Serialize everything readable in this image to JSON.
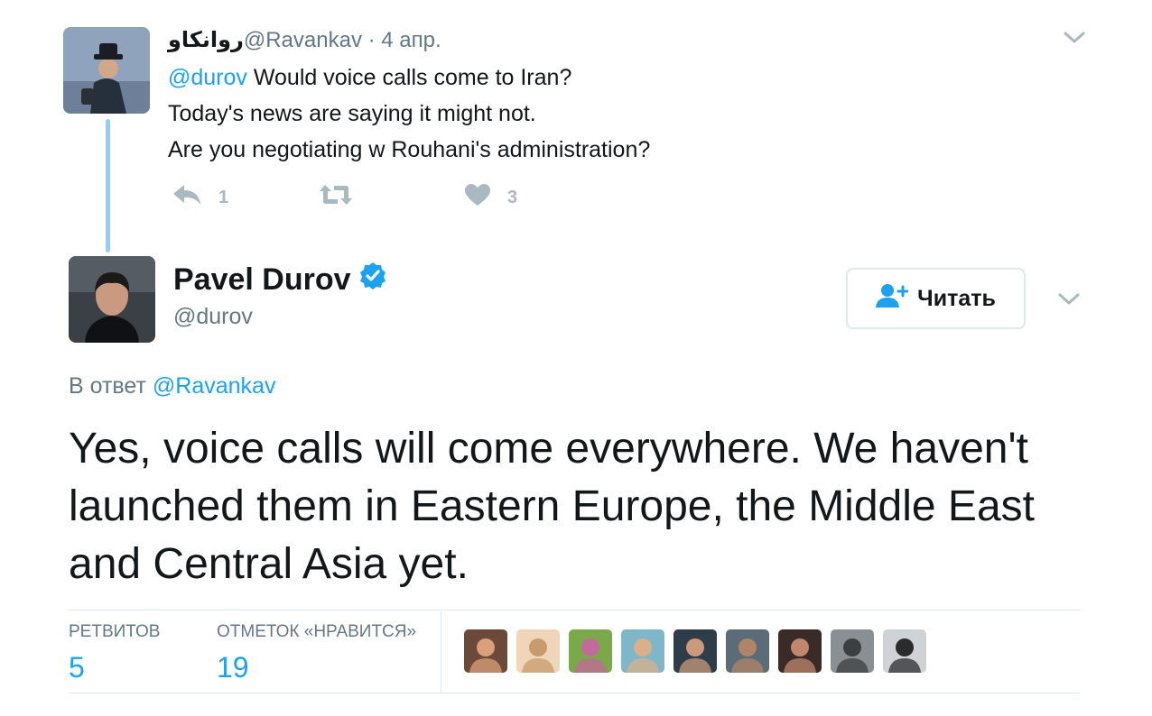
{
  "reply_tweet": {
    "author_name": "روانکاو",
    "author_handle": "@Ravankav",
    "separator": " · ",
    "date": "4 апр.",
    "mention": "@durov",
    "text_line1": " Would voice calls come to Iran?",
    "text_line2": "Today's news are saying it might not.",
    "text_line3": "Are you negotiating w Rouhani's administration?",
    "reply_count": "1",
    "like_count": "3"
  },
  "main_tweet": {
    "author_name": "Pavel Durov",
    "author_handle": "@durov",
    "follow_label": "Читать",
    "replying_prefix": "В ответ ",
    "replying_to": "@Ravankav",
    "text": "Yes, voice calls will come everywhere. We haven't launched them in Eastern Europe, the Middle East and Central Asia yet."
  },
  "stats": {
    "retweets_label": "РЕТВИТОВ",
    "retweets_value": "5",
    "likes_label": "ОТМЕТОК «НРАВИТСЯ»",
    "likes_value": "19"
  },
  "colors": {
    "accent": "#1da1f2",
    "thread_line": "#8ed0f9",
    "muted": "#657786",
    "icon_muted": "#aab8c2"
  },
  "likers": [
    {
      "name": "liker-avatar-1",
      "bg": "#6b4a3a",
      "fg": "#d9a07a"
    },
    {
      "name": "liker-avatar-2",
      "bg": "#f0d6b8",
      "fg": "#c89b6e"
    },
    {
      "name": "liker-avatar-3",
      "bg": "#7aa84a",
      "fg": "#c46a9a"
    },
    {
      "name": "liker-avatar-4",
      "bg": "#7fb6c9",
      "fg": "#d8b08a"
    },
    {
      "name": "liker-avatar-5",
      "bg": "#2f3d4a",
      "fg": "#c99a7c"
    },
    {
      "name": "liker-avatar-6",
      "bg": "#5b6b78",
      "fg": "#b08468"
    },
    {
      "name": "liker-avatar-7",
      "bg": "#3a2a28",
      "fg": "#c0876c"
    },
    {
      "name": "liker-avatar-8",
      "bg": "#8a8f94",
      "fg": "#3c3f42"
    },
    {
      "name": "liker-avatar-9",
      "bg": "#cfd3d6",
      "fg": "#2b2b2b"
    }
  ]
}
